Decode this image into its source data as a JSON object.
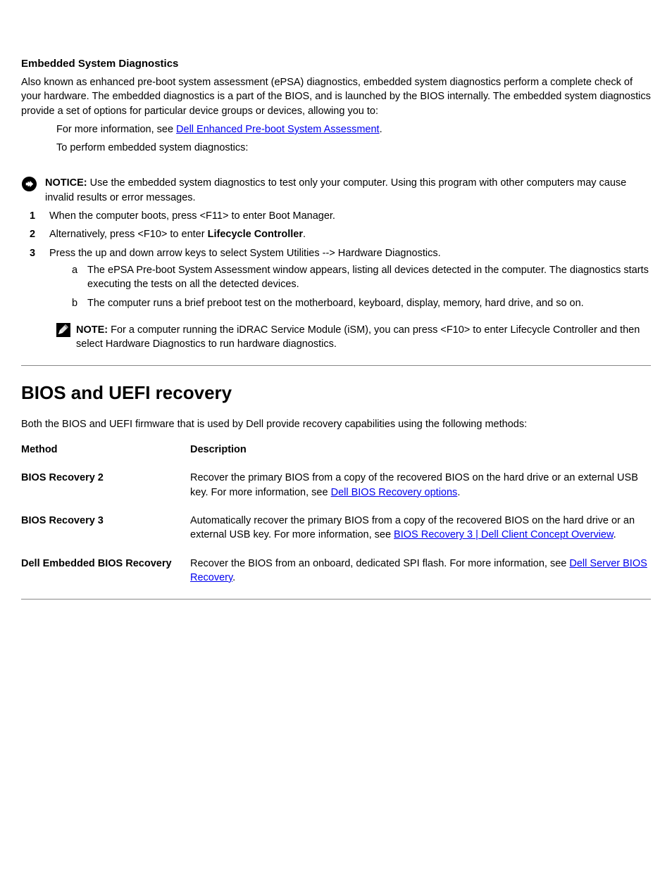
{
  "section1": {
    "title": "Embedded System Diagnostics",
    "p1": "Also known as enhanced pre-boot system assessment (ePSA) diagnostics, embedded system diagnostics perform a complete check of your hardware. The embedded diagnostics is a part of the BIOS, and is launched by the BIOS internally. The embedded system diagnostics provide a set of options for particular device groups or devices, allowing you to:",
    "refIntro": "For more information, see ",
    "refLink": "Dell Enhanced Pre-boot System Assessment",
    "refEnd": "."
  },
  "notice": {
    "label": "NOTICE:",
    "text": " Use the embedded system diagnostics to test only your computer. Using this program with other computers may cause invalid results or error messages."
  },
  "steps": {
    "s1": "When the computer boots, press <F11> to enter Boot Manager.",
    "s2_pre": "Alternatively, press <F10> to enter ",
    "s2_bold": "Lifecycle Controller",
    "s2_post": ".",
    "s3": "Press the up and down arrow keys to select System Utilities --> Hardware Diagnostics.",
    "noteLabel": "NOTE:",
    "noteText": " For a computer running the iDRAC Service Module (iSM), you can press <F10> to enter Lifecycle Controller and then select Hardware Diagnostics to run hardware diagnostics."
  },
  "table": {
    "heading": "BIOS and UEFI recovery",
    "col1_h": "Method",
    "col2_h": "Description",
    "rows": [
      {
        "c1": "BIOS Recovery 2",
        "c2_pre": "Recover the primary BIOS from a copy of the recovered BIOS on the hard drive or an external USB key. For more information, see ",
        "c2_link": "Dell BIOS Recovery options",
        "c2_post": "."
      },
      {
        "c1": "BIOS Recovery 3",
        "c2_pre": "Automatically recover the primary BIOS from a copy of the recovered BIOS on the hard drive or an external USB key. For more information, see ",
        "c2_link": "BIOS Recovery 3 | Dell Client Concept Overview",
        "c2_post": "."
      },
      {
        "c1": "Dell Embedded BIOS Recovery",
        "c2_pre": "Recover the BIOS from an onboard, dedicated SPI flash. For more information, see ",
        "c2_link": "Dell Server BIOS Recovery",
        "c2_post": "."
      }
    ]
  }
}
